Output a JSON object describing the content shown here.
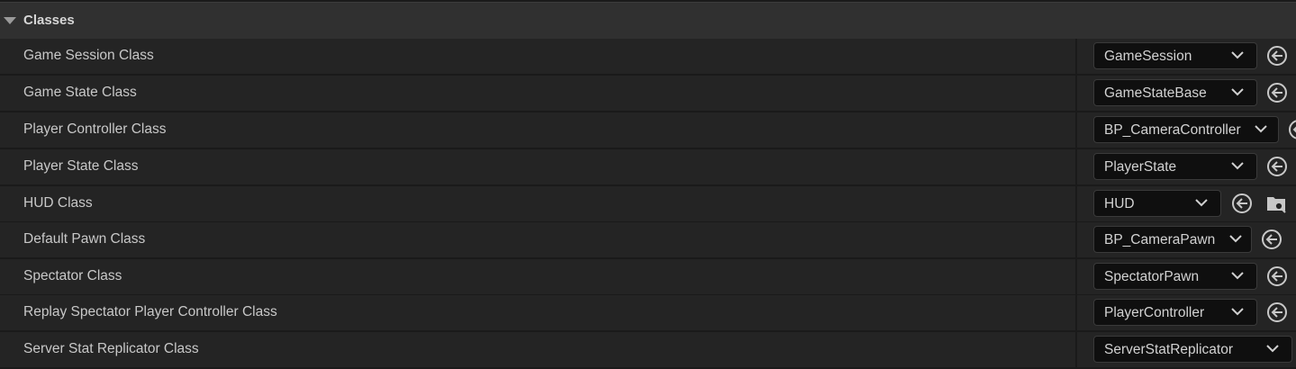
{
  "section": {
    "title": "Classes"
  },
  "rows": [
    {
      "label": "Game Session Class",
      "value": "GameSession"
    },
    {
      "label": "Game State Class",
      "value": "GameStateBase"
    },
    {
      "label": "Player Controller Class",
      "value": "BP_CameraController"
    },
    {
      "label": "Player State Class",
      "value": "PlayerState"
    },
    {
      "label": "HUD Class",
      "value": "HUD"
    },
    {
      "label": "Default Pawn Class",
      "value": "BP_CameraPawn"
    },
    {
      "label": "Spectator Class",
      "value": "SpectatorPawn"
    },
    {
      "label": "Replay Spectator Player Controller Class",
      "value": "PlayerController"
    },
    {
      "label": "Server Stat Replicator Class",
      "value": "ServerStatReplicator"
    }
  ],
  "icons": {
    "dropdown": "chevron-down-icon",
    "reset": "use-selected-asset-icon",
    "browse": "browse-asset-icon"
  }
}
